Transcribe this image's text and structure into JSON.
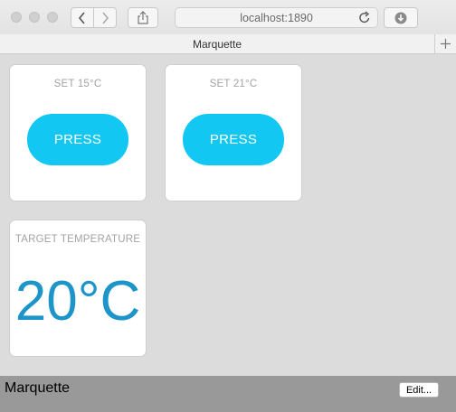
{
  "browser": {
    "url": "localhost:1890",
    "tab_title": "Marquette"
  },
  "dashboard": {
    "cards": [
      {
        "label": "SET 15°C",
        "button_label": "PRESS"
      },
      {
        "label": "SET 21°C",
        "button_label": "PRESS"
      }
    ],
    "target": {
      "label": "TARGET TEMPERATURE",
      "value": "20°C"
    }
  },
  "footer": {
    "title": "Marquette",
    "edit_label": "Edit..."
  },
  "colors": {
    "accent_button": "#12c7f2",
    "temperature_text": "#1d95c9",
    "footer_bg": "#999999"
  }
}
